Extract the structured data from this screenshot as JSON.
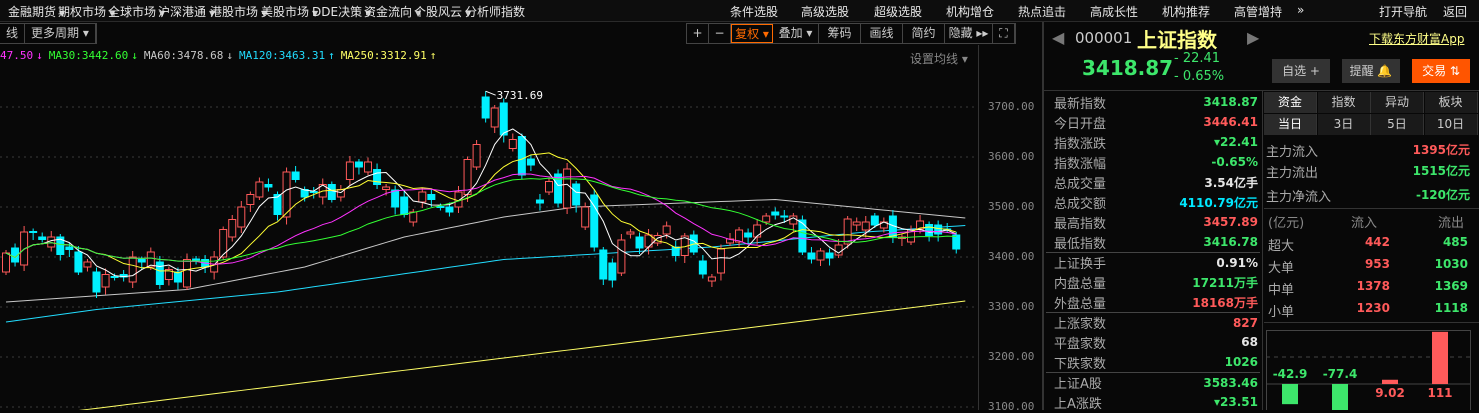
{
  "menu": [
    {
      "label": "金融期货",
      "caret": true
    },
    {
      "label": "期权市场",
      "caret": true
    },
    {
      "label": "全球市场",
      "caret": true
    },
    {
      "label": "沪深港通",
      "caret": true
    },
    {
      "label": "港股市场",
      "caret": true
    },
    {
      "label": "美股市场",
      "caret": true
    },
    {
      "label": "DDE决策",
      "caret": true
    },
    {
      "label": "资金流向",
      "caret": true
    },
    {
      "label": "个股风云",
      "caret": true
    },
    {
      "label": "分析师指数",
      "caret": false
    },
    {
      "label": "条件选股",
      "caret": false
    },
    {
      "label": "高级选股",
      "caret": false
    },
    {
      "label": "超级选股",
      "caret": false
    },
    {
      "label": "机构增仓",
      "caret": false
    },
    {
      "label": "热点追击",
      "caret": false
    },
    {
      "label": "高成长性",
      "caret": false
    },
    {
      "label": "机构推荐",
      "caret": false
    },
    {
      "label": "高管增持",
      "caret": false
    },
    {
      "label": "»",
      "caret": false
    },
    {
      "label": "打开导航",
      "caret": false
    },
    {
      "label": "返回",
      "caret": false
    }
  ],
  "toolbar": {
    "left": [
      "线",
      "更多周期 ▾"
    ],
    "right": [
      {
        "label": "+"
      },
      {
        "label": "−"
      },
      {
        "label": "复权 ▾",
        "active": true
      },
      {
        "label": "叠加 ▾"
      },
      {
        "label": "筹码"
      },
      {
        "label": "画线"
      },
      {
        "label": "简约"
      },
      {
        "label": "隐藏 ▸▸"
      },
      {
        "label": "⛶"
      }
    ]
  },
  "ma_legend": [
    {
      "text": "47.50",
      "arrow": "↓",
      "color": "#ff33ff"
    },
    {
      "text": "MA30:3442.60",
      "arrow": "↓",
      "color": "#33ff33"
    },
    {
      "text": "MA60:3478.68",
      "arrow": "↓",
      "color": "#c8c8c8"
    },
    {
      "text": "MA120:3463.31",
      "arrow": "↑",
      "color": "#22ddff"
    },
    {
      "text": "MA250:3312.91",
      "arrow": "↑",
      "color": "#ffff66"
    }
  ],
  "set_ma": "设置均线 ▾",
  "chart_data": {
    "type": "candlestick",
    "y_ticks": [
      "3700.00",
      "3600.00",
      "3500.00",
      "3400.00",
      "3300.00",
      "3200.00",
      "3100.00"
    ],
    "ylim": [
      3100,
      3760
    ],
    "candles_open_close": [
      [
        3370,
        3408
      ],
      [
        3418,
        3390
      ],
      [
        3384,
        3450
      ],
      [
        3451,
        3449
      ],
      [
        3440,
        3435
      ],
      [
        3420,
        3440
      ],
      [
        3440,
        3405
      ],
      [
        3420,
        3415
      ],
      [
        3410,
        3370
      ],
      [
        3380,
        3390
      ],
      [
        3370,
        3330
      ],
      [
        3340,
        3365
      ],
      [
        3361,
        3359
      ],
      [
        3365,
        3360
      ],
      [
        3350,
        3400
      ],
      [
        3395,
        3390
      ],
      [
        3380,
        3410
      ],
      [
        3390,
        3345
      ],
      [
        3355,
        3375
      ],
      [
        3370,
        3350
      ],
      [
        3340,
        3395
      ],
      [
        3396,
        3394
      ],
      [
        3395,
        3380
      ],
      [
        3370,
        3400
      ],
      [
        3400,
        3455
      ],
      [
        3440,
        3475
      ],
      [
        3460,
        3500
      ],
      [
        3505,
        3525
      ],
      [
        3520,
        3550
      ],
      [
        3545,
        3540
      ],
      [
        3525,
        3485
      ],
      [
        3480,
        3570
      ],
      [
        3570,
        3555
      ],
      [
        3535,
        3520
      ],
      [
        3531,
        3529
      ],
      [
        3520,
        3545
      ],
      [
        3545,
        3515
      ],
      [
        3520,
        3535
      ],
      [
        3555,
        3590
      ],
      [
        3590,
        3580
      ],
      [
        3570,
        3590
      ],
      [
        3575,
        3545
      ],
      [
        3535,
        3540
      ],
      [
        3534,
        3500
      ],
      [
        3520,
        3485
      ],
      [
        3470,
        3490
      ],
      [
        3510,
        3530
      ],
      [
        3525,
        3515
      ],
      [
        3501,
        3499
      ],
      [
        3500,
        3490
      ],
      [
        3500,
        3530
      ],
      [
        3525,
        3595
      ],
      [
        3580,
        3625
      ],
      [
        3720,
        3678
      ],
      [
        3660,
        3698
      ],
      [
        3708,
        3644
      ],
      [
        3617,
        3635
      ],
      [
        3641,
        3564
      ],
      [
        3596,
        3584
      ],
      [
        3514,
        3508
      ],
      [
        3530,
        3551
      ],
      [
        3566,
        3508
      ],
      [
        3498,
        3576
      ],
      [
        3546,
        3504
      ],
      [
        3460,
        3500
      ],
      [
        3524,
        3420
      ],
      [
        3414,
        3356
      ],
      [
        3388,
        3354
      ],
      [
        3368,
        3434
      ],
      [
        3446,
        3450
      ],
      [
        3440,
        3418
      ],
      [
        3420,
        3444
      ],
      [
        3428,
        3443
      ],
      [
        3446,
        3462
      ],
      [
        3420,
        3403
      ],
      [
        3403,
        3442
      ],
      [
        3444,
        3410
      ],
      [
        3392,
        3366
      ],
      [
        3352,
        3360
      ],
      [
        3368,
        3416
      ],
      [
        3428,
        3436
      ],
      [
        3430,
        3454
      ],
      [
        3448,
        3440
      ],
      [
        3440,
        3464
      ],
      [
        3470,
        3482
      ],
      [
        3490,
        3484
      ],
      [
        3482,
        3480
      ],
      [
        3466,
        3482
      ],
      [
        3474,
        3410
      ],
      [
        3408,
        3396
      ],
      [
        3394,
        3412
      ],
      [
        3408,
        3398
      ],
      [
        3404,
        3424
      ],
      [
        3426,
        3476
      ],
      [
        3464,
        3470
      ],
      [
        3454,
        3470
      ],
      [
        3482,
        3464
      ],
      [
        3458,
        3470
      ],
      [
        3482,
        3440
      ],
      [
        3437,
        3440
      ],
      [
        3430,
        3454
      ],
      [
        3456,
        3472
      ],
      [
        3465,
        3443
      ],
      [
        3464,
        3446
      ],
      [
        3456,
        3454
      ],
      [
        3444,
        3416
      ]
    ],
    "high_label": "3731.69",
    "high_value": 3731.69,
    "ma_short": [
      {
        "period": 5,
        "color": "#ffffff"
      },
      {
        "period": 10,
        "color": "#ffff33"
      },
      {
        "period": 20,
        "color": "#ff33ff"
      },
      {
        "period": 30,
        "color": "#33ff33"
      }
    ],
    "ma_long": [
      {
        "name": "MA60",
        "color": "#c8c8c8",
        "points": [
          [
            0,
            3310
          ],
          [
            20,
            3335
          ],
          [
            33,
            3380
          ],
          [
            44,
            3440
          ],
          [
            55,
            3480
          ],
          [
            63,
            3500
          ],
          [
            85,
            3515
          ],
          [
            106,
            3478
          ]
        ]
      },
      {
        "name": "MA120",
        "color": "#22ddff",
        "points": [
          [
            0,
            3270
          ],
          [
            10,
            3295
          ],
          [
            30,
            3330
          ],
          [
            55,
            3395
          ],
          [
            78,
            3420
          ],
          [
            95,
            3450
          ],
          [
            106,
            3463
          ]
        ]
      },
      {
        "name": "MA250",
        "color": "#ffff66",
        "points": [
          [
            0,
            3075
          ],
          [
            106,
            3312
          ]
        ]
      }
    ],
    "colors": {
      "up": "#ff5a5a",
      "down": "#00f0ff"
    }
  },
  "quote": {
    "code": "000001",
    "name": "上证指数",
    "download": "下载东方财富App",
    "price": "3418.87",
    "change": "- 22.41",
    "pct": "- 0.65%",
    "buttons": {
      "watch": "自选 +",
      "alert": "提醒 🔔",
      "trade": "交易 ⇅"
    }
  },
  "stats": [
    {
      "k": "最新指数",
      "v": "3418.87",
      "c": "green"
    },
    {
      "k": "今日开盘",
      "v": "3446.41",
      "c": "red"
    },
    {
      "k": "指数涨跌",
      "v": "▾22.41",
      "c": "green"
    },
    {
      "k": "指数涨幅",
      "v": "-0.65%",
      "c": "green"
    },
    {
      "k": "总成交量",
      "v": "3.54亿手",
      "c": "white"
    },
    {
      "k": "总成交额",
      "v": "4110.79亿元",
      "c": "cyan"
    },
    {
      "k": "最高指数",
      "v": "3457.89",
      "c": "red"
    },
    {
      "k": "最低指数",
      "v": "3416.78",
      "c": "green",
      "sep": true
    },
    {
      "k": "上证换手",
      "v": "0.91%",
      "c": "white"
    },
    {
      "k": "内盘总量",
      "v": "17211万手",
      "c": "green"
    },
    {
      "k": "外盘总量",
      "v": "18168万手",
      "c": "red",
      "sep": true
    },
    {
      "k": "上涨家数",
      "v": "827",
      "c": "red"
    },
    {
      "k": "平盘家数",
      "v": "68",
      "c": "white"
    },
    {
      "k": "下跌家数",
      "v": "1026",
      "c": "green",
      "sep": true
    },
    {
      "k": "上证A股",
      "v": "3583.46",
      "c": "green"
    },
    {
      "k": "上A涨跌",
      "v": "▾23.51",
      "c": "green"
    }
  ],
  "fund_tabs": [
    "资金",
    "指数",
    "异动",
    "板块"
  ],
  "period_tabs": [
    "当日",
    "3日",
    "5日",
    "10日"
  ],
  "flows": [
    {
      "k": "主力流入",
      "v": "1395亿元",
      "c": "red"
    },
    {
      "k": "主力流出",
      "v": "1515亿元",
      "c": "green"
    },
    {
      "k": "主力净流入",
      "v": "-120亿元",
      "c": "green"
    }
  ],
  "order_table": {
    "header": [
      "(亿元)",
      "流入",
      "流出"
    ],
    "rows": [
      {
        "k": "超大",
        "in": "442",
        "out": "485"
      },
      {
        "k": "大单",
        "in": "953",
        "out": "1030"
      },
      {
        "k": "中单",
        "in": "1378",
        "out": "1369"
      },
      {
        "k": "小单",
        "in": "1230",
        "out": "1118"
      }
    ]
  },
  "net_bars": [
    {
      "label": "-42.9",
      "value": -42.9
    },
    {
      "label": "-77.4",
      "value": -77.4
    },
    {
      "label": "9.02",
      "value": 9.02
    },
    {
      "label": "111",
      "value": 111
    }
  ]
}
